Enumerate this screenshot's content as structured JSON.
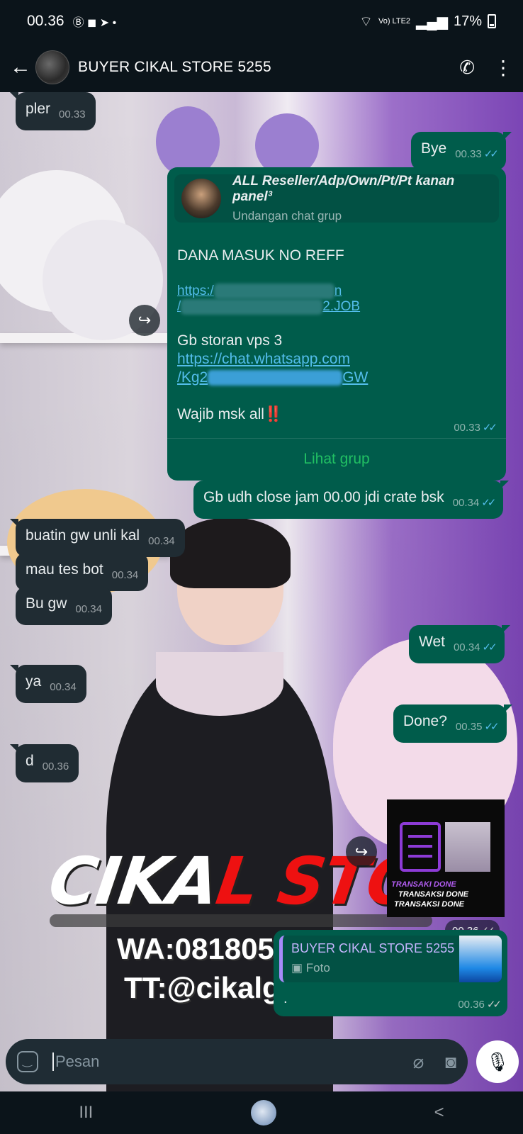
{
  "status_bar": {
    "time": "00.36",
    "left_icons": "Ⓑ ◼ ➤ •",
    "network": "Vo) LTE2",
    "battery": "17%"
  },
  "header": {
    "back_icon": "arrow-left",
    "title": "BUYER CIKAL STORE 5255",
    "call_icon": "add-call",
    "menu_icon": "more-vert"
  },
  "messages": [
    {
      "id": "m1",
      "dir": "in",
      "text": "pler",
      "time": "00.33"
    },
    {
      "id": "m2",
      "dir": "out",
      "text": "Bye",
      "time": "00.33",
      "read": true
    },
    {
      "id": "m3",
      "dir": "out",
      "type": "group_invite",
      "group_name": "ALL Reseller/Adp/Own/Pt/Pt kanan panel³",
      "group_subtitle": "Undangan chat grup",
      "lines": [
        "DANA MASUK NO REFF",
        "Gb storan vps 3",
        "https://chat.whatsapp.com",
        "/Kg2",
        "GW",
        "Wajib msk all‼️"
      ],
      "blurred_link_partial": [
        "https:/",
        "n",
        "/",
        "2.JOB"
      ],
      "time": "00.33",
      "action": "Lihat grup"
    },
    {
      "id": "m4",
      "dir": "out",
      "text": "Gb udh close jam 00.00 jdi crate bsk",
      "time": "00.34"
    },
    {
      "id": "m5",
      "dir": "in",
      "text": "buatin gw unli kal",
      "time": "00.34"
    },
    {
      "id": "m6",
      "dir": "in",
      "text": "mau tes bot",
      "time": "00.34"
    },
    {
      "id": "m7",
      "dir": "in",
      "text": "Bu gw",
      "time": "00.34"
    },
    {
      "id": "m8",
      "dir": "out",
      "text": "Wet",
      "time": "00.34"
    },
    {
      "id": "m9",
      "dir": "in",
      "text": "ya",
      "time": "00.34"
    },
    {
      "id": "m10",
      "dir": "out",
      "text": "Done?",
      "time": "00.35"
    },
    {
      "id": "m11",
      "dir": "in",
      "text": "d",
      "time": "00.36"
    },
    {
      "id": "m12",
      "dir": "out",
      "type": "image",
      "caption_lines": [
        "TRANSAKI DONE",
        "TRANSAKSI DONE",
        "TRANSAKSI DONE"
      ],
      "time": "00.36"
    },
    {
      "id": "m13",
      "dir": "out",
      "type": "reply",
      "quoted_name": "BUYER CIKAL STORE 5255",
      "quoted_type": "Foto",
      "text": ".",
      "time": "00.36"
    }
  ],
  "wallpaper": {
    "brand_left": "CIKA",
    "brand_right": "L STOR",
    "wa": "WA:081805",
    "tt": "TT:@cikalg"
  },
  "input": {
    "placeholder": "Pesan",
    "attach_icon": "paperclip",
    "camera_icon": "camera",
    "mic_icon": "mic",
    "emoji_icon": "sticker"
  },
  "nav": {
    "recent": "III",
    "back": "<"
  },
  "colors": {
    "incoming": "#202c33",
    "outgoing": "#005c4b",
    "read_tick": "#53bdeb",
    "accent_green": "#21c063"
  }
}
